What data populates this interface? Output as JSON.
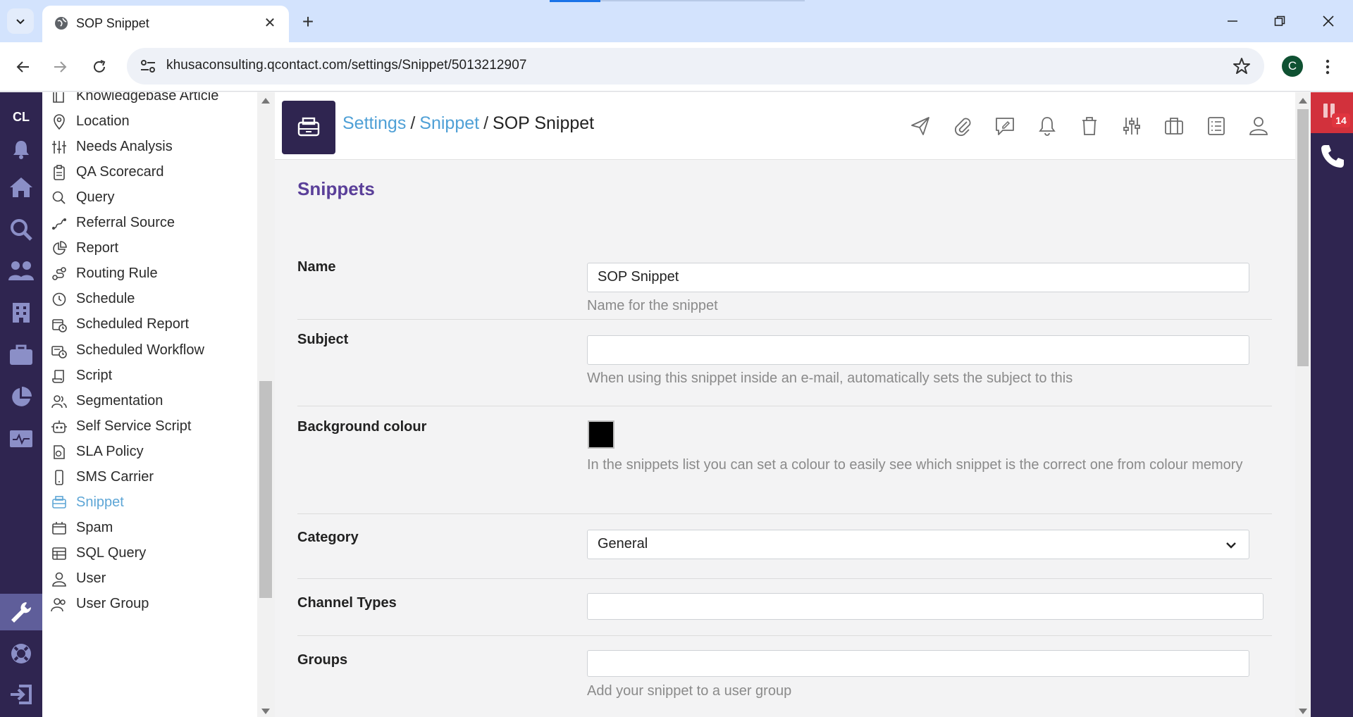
{
  "browser": {
    "tab_title": "SOP Snippet",
    "url": "khusaconsulting.qcontact.com/settings/Snippet/5013212907",
    "profile_initial": "C"
  },
  "left_rail": {
    "logo": "CL",
    "icons": [
      "bell-icon",
      "home-icon",
      "search-icon",
      "users-icon",
      "building-icon",
      "briefcase-icon",
      "chart-pie-icon",
      "monitor-pulse-icon",
      "wrench-icon",
      "lifebuoy-icon",
      "logout-icon"
    ]
  },
  "sidebar": {
    "items": [
      {
        "label": "Knowledgebase Article",
        "icon": "book-icon"
      },
      {
        "label": "Location",
        "icon": "map-pin-icon"
      },
      {
        "label": "Needs Analysis",
        "icon": "sliders-icon"
      },
      {
        "label": "QA Scorecard",
        "icon": "clipboard-icon"
      },
      {
        "label": "Query",
        "icon": "search-icon"
      },
      {
        "label": "Referral Source",
        "icon": "route-icon"
      },
      {
        "label": "Report",
        "icon": "chart-pie-icon"
      },
      {
        "label": "Routing Rule",
        "icon": "routing-icon"
      },
      {
        "label": "Schedule",
        "icon": "clock-icon"
      },
      {
        "label": "Scheduled Report",
        "icon": "calendar-clock-icon"
      },
      {
        "label": "Scheduled Workflow",
        "icon": "workflow-clock-icon"
      },
      {
        "label": "Script",
        "icon": "script-icon"
      },
      {
        "label": "Segmentation",
        "icon": "users-segment-icon"
      },
      {
        "label": "Self Service Script",
        "icon": "robot-icon"
      },
      {
        "label": "SLA Policy",
        "icon": "policy-icon"
      },
      {
        "label": "SMS Carrier",
        "icon": "phone-device-icon"
      },
      {
        "label": "Snippet",
        "icon": "snippet-icon",
        "active": true
      },
      {
        "label": "Spam",
        "icon": "spam-icon"
      },
      {
        "label": "SQL Query",
        "icon": "table-icon"
      },
      {
        "label": "User",
        "icon": "user-icon"
      },
      {
        "label": "User Group",
        "icon": "user-group-icon"
      }
    ]
  },
  "header": {
    "breadcrumb": {
      "root": "Settings",
      "sep1": "/",
      "parent": "Snippet",
      "sep2": "/",
      "current": "SOP Snippet"
    },
    "actions": [
      "send-icon",
      "paperclip-icon",
      "note-icon",
      "bell-icon",
      "trash-icon",
      "sliders-icon",
      "briefcase-icon",
      "list-icon",
      "user-icon"
    ]
  },
  "form": {
    "section_title": "Snippets",
    "name": {
      "label": "Name",
      "value": "SOP Snippet",
      "help": "Name for the snippet"
    },
    "subject": {
      "label": "Subject",
      "value": "",
      "help": "When using this snippet inside an e-mail, automatically sets the subject to this"
    },
    "background_colour": {
      "label": "Background colour",
      "value": "#000000",
      "help": "In the snippets list you can set a colour to easily see which snippet is the correct one from colour memory"
    },
    "category": {
      "label": "Category",
      "value": "General"
    },
    "channel_types": {
      "label": "Channel Types",
      "value": ""
    },
    "groups": {
      "label": "Groups",
      "value": "",
      "help": "Add your snippet to a user group"
    }
  },
  "right_rail": {
    "badge_count": "14",
    "icons": [
      "pause-icon",
      "phone-icon"
    ]
  },
  "colors": {
    "brand_dark": "#2f2550",
    "accent_purple": "#5a3f99",
    "link_blue": "#4fa0d6",
    "alert_red": "#d2313c"
  }
}
